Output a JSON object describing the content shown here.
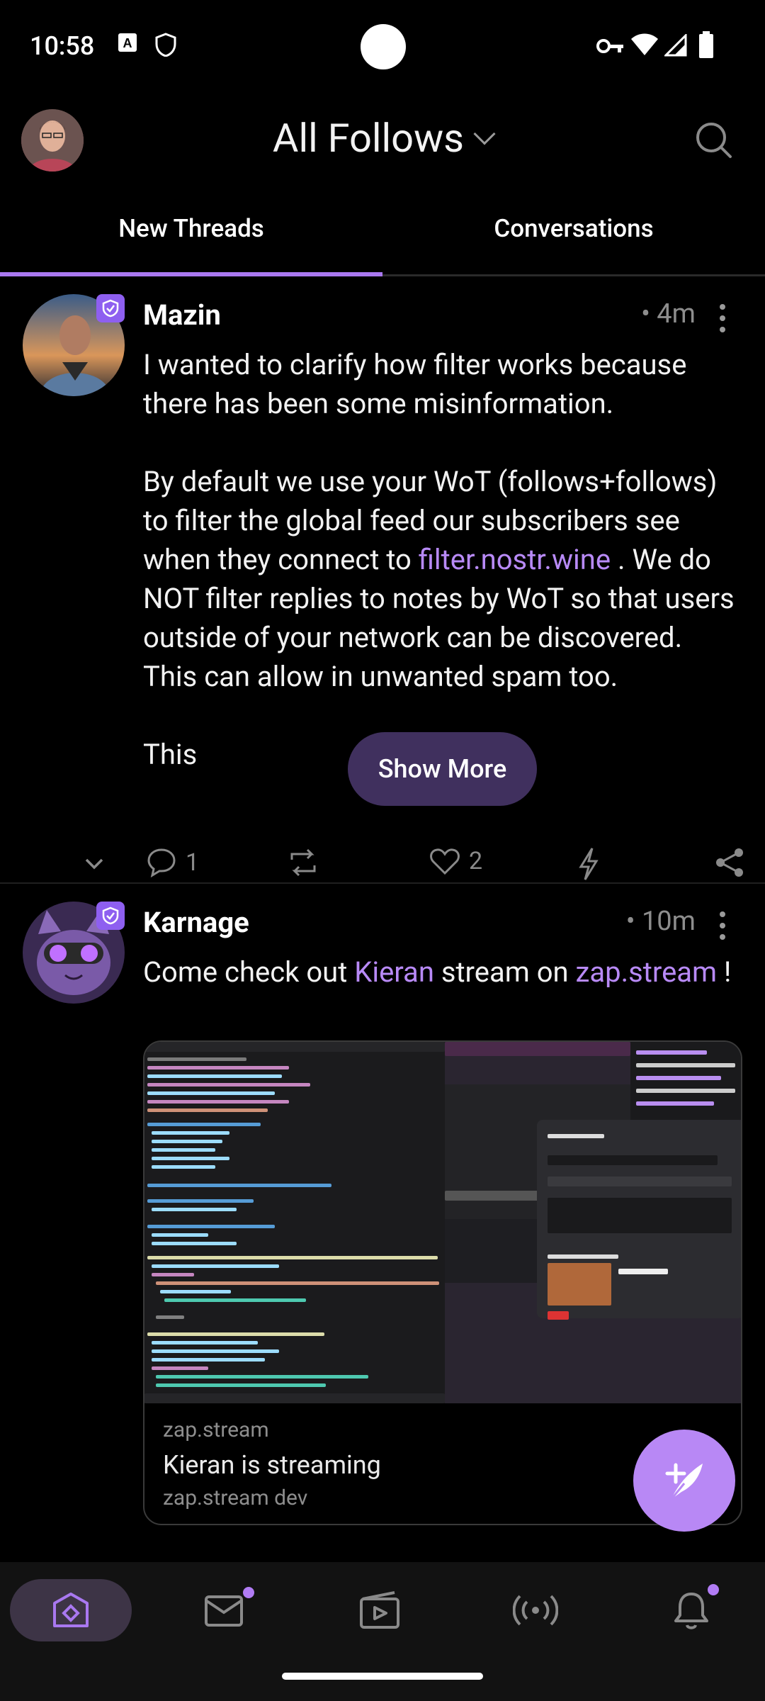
{
  "status_bar": {
    "time": "10:58"
  },
  "header": {
    "title": "All Follows"
  },
  "tabs": [
    {
      "label": "New Threads",
      "active": true
    },
    {
      "label": "Conversations",
      "active": false
    }
  ],
  "posts": [
    {
      "author": "Mazin",
      "time": "• 4m",
      "paragraph1": "I wanted to clarify how filter works because there has been some misinformation.",
      "p2_before": "By default we use your WoT (follows+follows) to filter the global feed our subscribers see when they connect to ",
      "p2_link": "filter.nostr.wine",
      "p2_after": " . We do NOT filter replies to notes by WoT so that users outside of your network can be discovered. This can allow in unwanted spam too.",
      "truncated_start": "This",
      "show_more_label": "Show More",
      "reply_count": "1",
      "like_count": "2"
    },
    {
      "author": "Karnage",
      "time": "• 10m",
      "text_before": "Come check out ",
      "mention": "Kieran",
      "text_middle": " stream on ",
      "link": "zap.stream",
      "text_after": " !",
      "preview": {
        "site": "zap.stream",
        "title": "Kieran is streaming",
        "description": "zap.stream dev"
      }
    }
  ],
  "colors": {
    "accent": "#a978f0",
    "link": "#b88af7",
    "fab": "#b888f5",
    "muted": "#8d8d8d",
    "background": "#000000"
  },
  "icons": [
    "search-icon",
    "chevron-down-icon",
    "reply-icon",
    "repost-icon",
    "like-icon",
    "zap-icon",
    "share-icon",
    "compose-icon",
    "home-icon",
    "messages-icon",
    "video-icon",
    "live-icon",
    "notifications-icon"
  ]
}
